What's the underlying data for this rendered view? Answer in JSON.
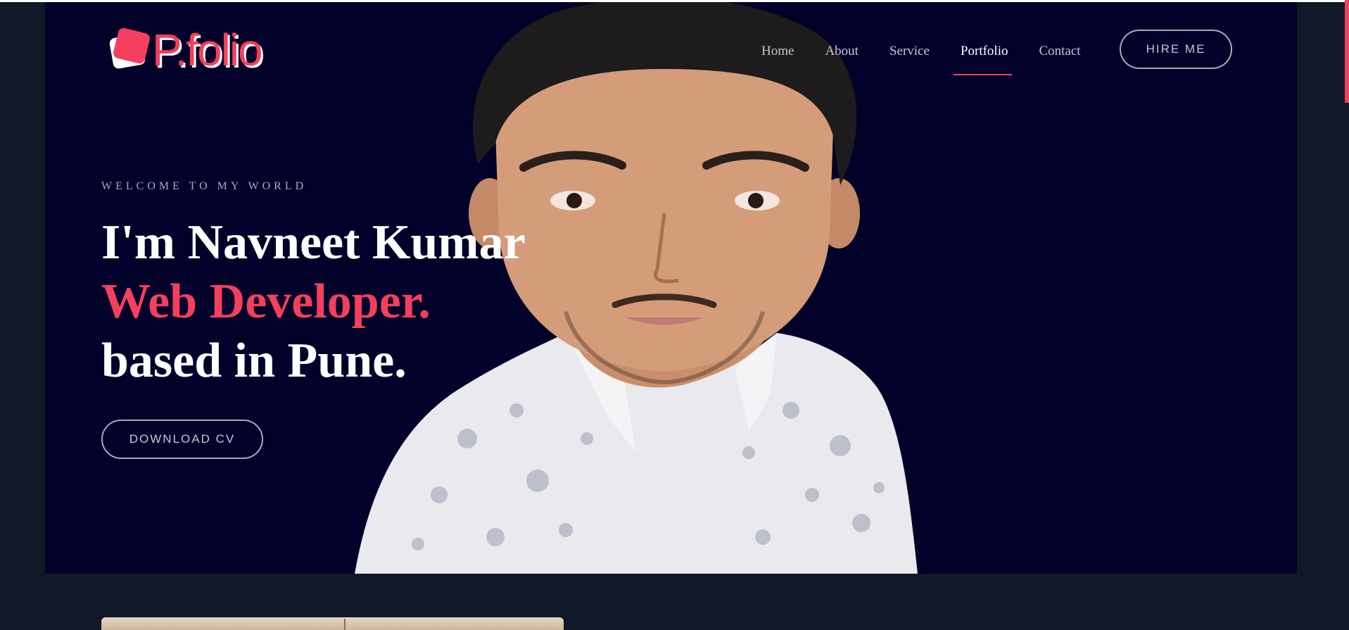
{
  "brand": {
    "logo_text": "P.folio",
    "accent_color": "#f43f5e"
  },
  "nav": {
    "items": [
      {
        "label": "Home"
      },
      {
        "label": "About"
      },
      {
        "label": "Service"
      },
      {
        "label": "Portfolio",
        "active": true
      },
      {
        "label": "Contact"
      }
    ],
    "cta_label": "HIRE ME"
  },
  "hero": {
    "eyebrow": "WELCOME TO MY WORLD",
    "line1": "I'm Navneet Kumar",
    "line2": "Web Developer.",
    "line3": "based in Pune.",
    "cta_label": "DOWNLOAD CV",
    "background_color": "#01012a"
  },
  "icons": [
    "logo-mark-icon"
  ],
  "colors": {
    "page_bg": "#111827",
    "hero_bg": "#01012a",
    "accent": "#f43f5e",
    "muted_text": "#c6c8d0"
  }
}
